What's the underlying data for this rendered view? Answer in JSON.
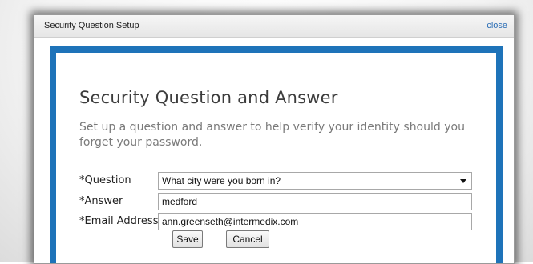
{
  "dialog": {
    "title": "Security Question Setup",
    "close_label": "close"
  },
  "form": {
    "heading": "Security Question and Answer",
    "intro": "Set up a question and answer to help verify your identity should you forget your password.",
    "question_label": "*Question",
    "question_value": "What city were you born in?",
    "answer_label": "*Answer",
    "answer_value": "medford",
    "email_label": "*Email Address",
    "email_value": "ann.greenseth@intermedix.com",
    "save_label": "Save",
    "cancel_label": "Cancel"
  },
  "colors": {
    "frame": "#1e73b9",
    "link": "#2a6db5"
  }
}
